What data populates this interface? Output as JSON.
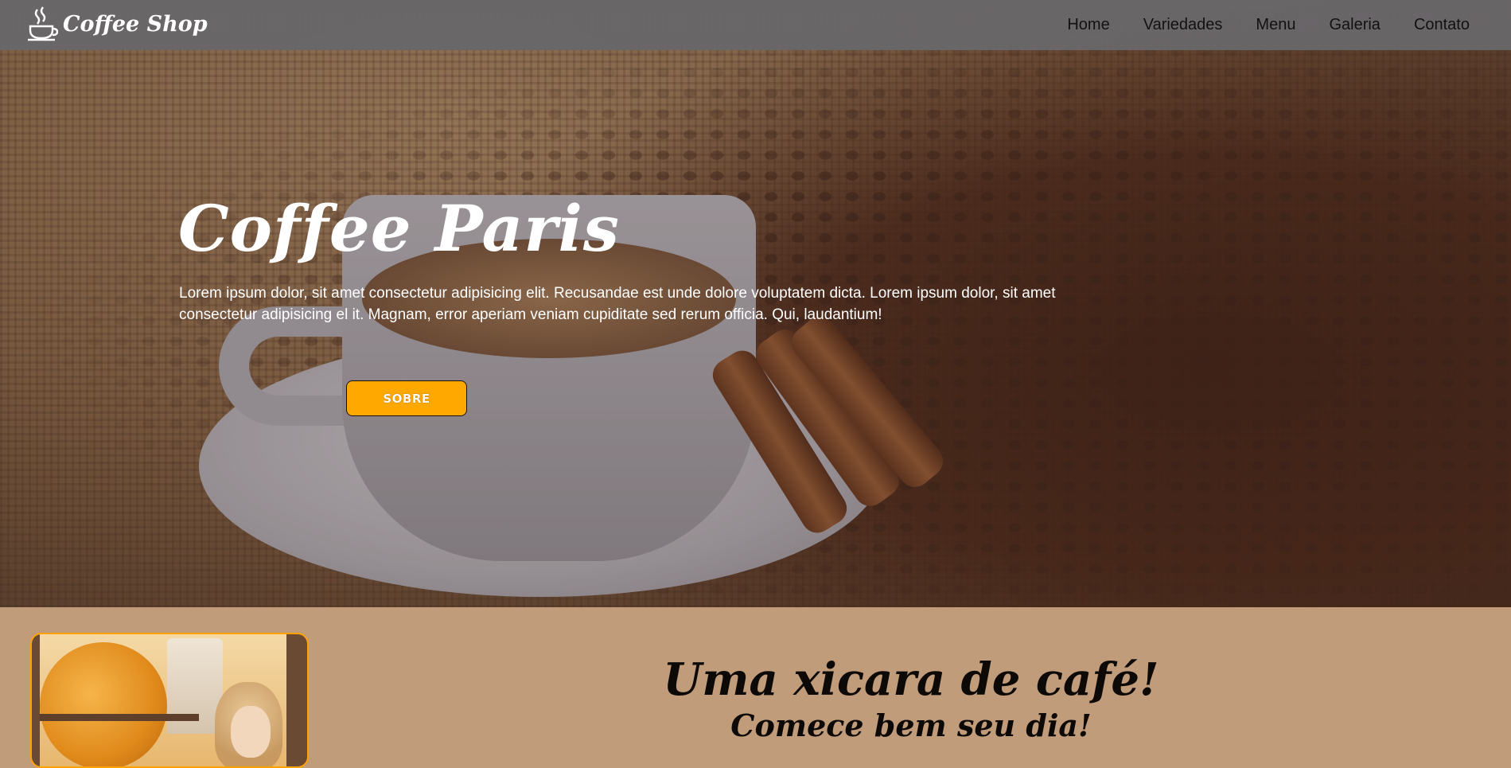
{
  "navbar": {
    "brand": "Coffee Shop",
    "brand_icon": "coffee-cup-icon",
    "links": [
      "Home",
      "Variedades",
      "Menu",
      "Galeria",
      "Contato"
    ]
  },
  "hero": {
    "title": "Coffee Paris",
    "text": "Lorem ipsum dolor, sit amet consectetur adipisicing elit. Recusandae est unde dolore voluptatem dicta. Lorem ipsum dolor, sit amet consectetur adipisicing el it. Magnam, error aperiam veniam cupiditate sed rerum officia. Qui, laudantium!",
    "button_label": "SOBRE"
  },
  "about": {
    "title": "Uma xicara de café!",
    "subtitle": "Comece bem seu dia!"
  },
  "colors": {
    "navbar_bg": "#69676a",
    "accent": "#ffa800",
    "section_bg": "#c19c7b",
    "card_border": "#ffa200"
  }
}
